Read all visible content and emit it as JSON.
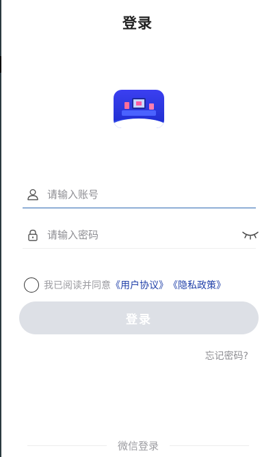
{
  "header": {
    "title": "登录"
  },
  "logo": {
    "icon": "app-logo-icon"
  },
  "form": {
    "account": {
      "placeholder": "请输入账号",
      "icon": "user-icon"
    },
    "password": {
      "placeholder": "请输入密码",
      "icon": "lock-icon",
      "toggle_icon": "eye-closed-icon"
    }
  },
  "agreement": {
    "text": "我已阅读并同意",
    "user_agreement": "《用户协议》",
    "privacy_policy": "《隐私政策》"
  },
  "login_button": {
    "label": "登录"
  },
  "forgot_password": {
    "label": "忘记密码?"
  },
  "wechat_login": {
    "label": "微信登录"
  },
  "colors": {
    "primary_blue": "#2a67b1",
    "link_blue": "#1f3fa8",
    "button_disabled": "#dde0e6",
    "placeholder_gray": "#8e8e93"
  }
}
